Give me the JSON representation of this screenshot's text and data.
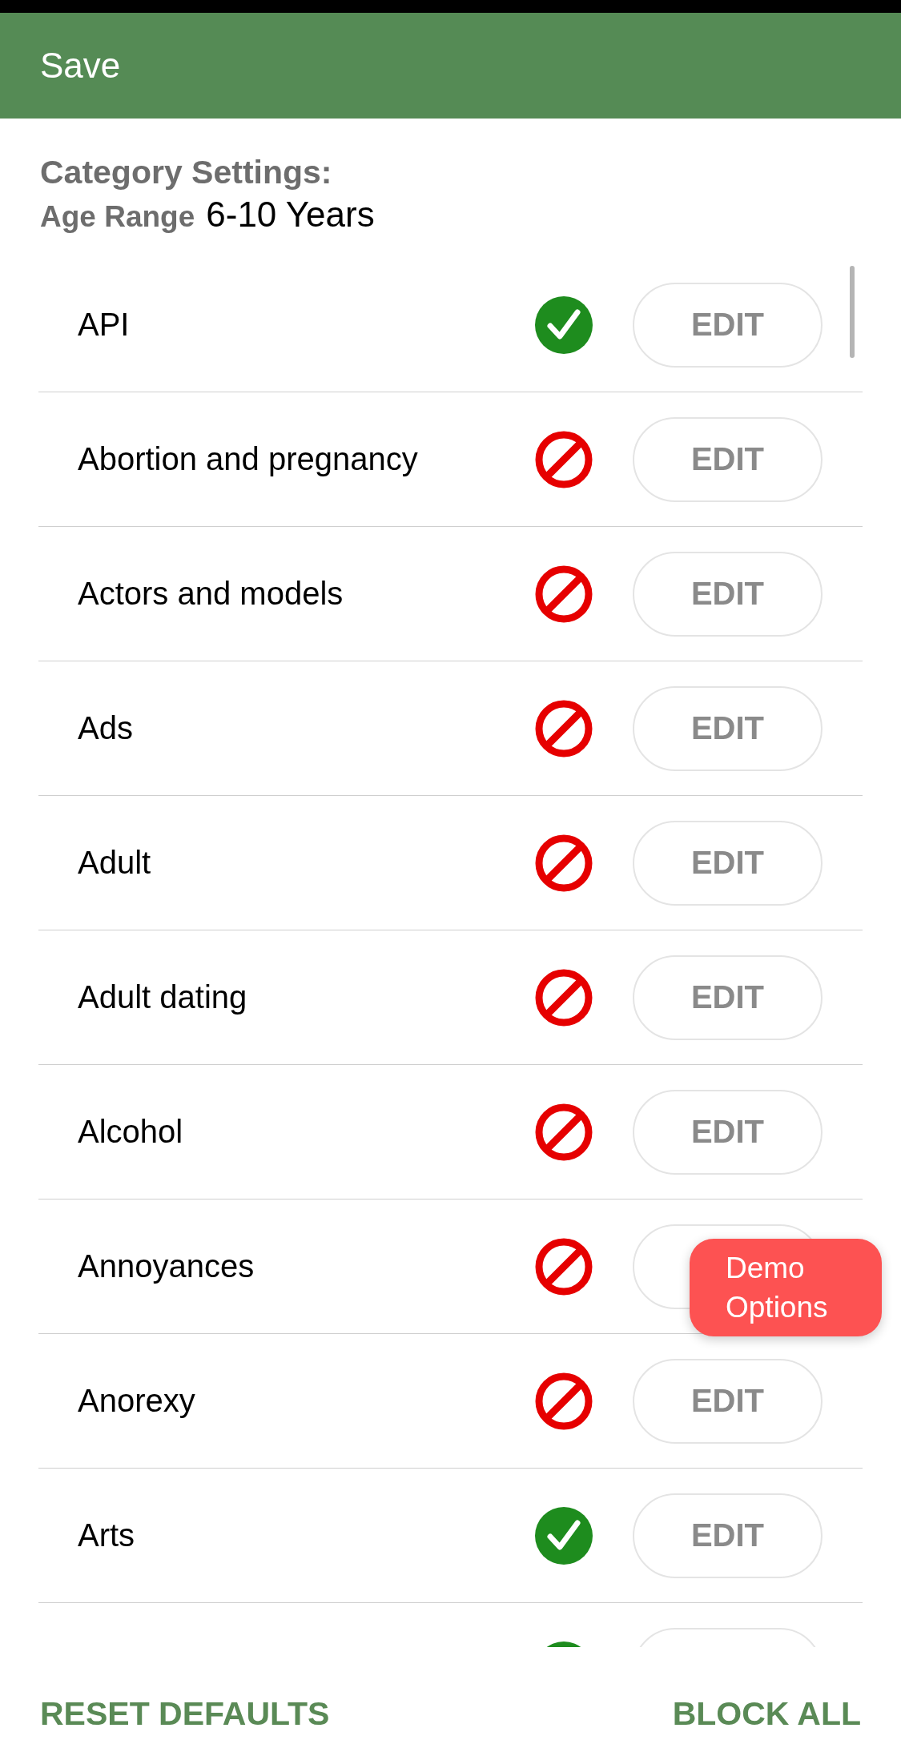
{
  "header": {
    "save": "Save"
  },
  "title": "Category Settings:",
  "age_range": {
    "label": "Age Range",
    "value": "6-10 Years"
  },
  "rows": [
    {
      "name": "API",
      "allowed": true,
      "edit": "EDIT"
    },
    {
      "name": "Abortion and pregnancy",
      "allowed": false,
      "edit": "EDIT"
    },
    {
      "name": "Actors and models",
      "allowed": false,
      "edit": "EDIT"
    },
    {
      "name": "Ads",
      "allowed": false,
      "edit": "EDIT"
    },
    {
      "name": "Adult",
      "allowed": false,
      "edit": "EDIT"
    },
    {
      "name": "Adult dating",
      "allowed": false,
      "edit": "EDIT"
    },
    {
      "name": "Alcohol",
      "allowed": false,
      "edit": "EDIT"
    },
    {
      "name": "Annoyances",
      "allowed": false
    },
    {
      "name": "Anorexy",
      "allowed": false,
      "edit": "EDIT"
    },
    {
      "name": "Arts",
      "allowed": true,
      "edit": "EDIT"
    },
    {
      "allowed": true
    }
  ],
  "demo_button": {
    "label": "Demo\nOptions"
  },
  "footer": {
    "reset": "RESET DEFAULTS",
    "block_all": "BLOCK ALL"
  }
}
